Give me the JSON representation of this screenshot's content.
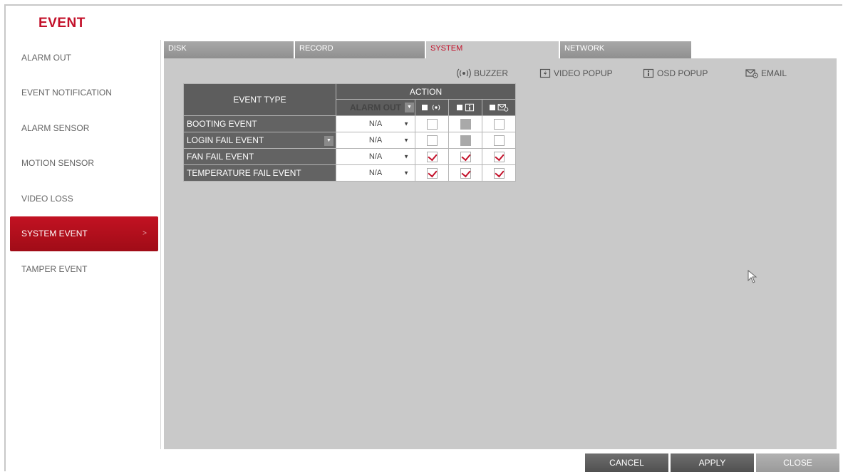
{
  "app_title": "EVENT",
  "sidebar": {
    "items": [
      {
        "label": "ALARM OUT"
      },
      {
        "label": "EVENT NOTIFICATION"
      },
      {
        "label": "ALARM SENSOR"
      },
      {
        "label": "MOTION SENSOR"
      },
      {
        "label": "VIDEO LOSS"
      },
      {
        "label": "SYSTEM EVENT",
        "active": true
      },
      {
        "label": "TAMPER EVENT"
      }
    ],
    "active_chevron": ">"
  },
  "tabs": [
    {
      "label": "DISK"
    },
    {
      "label": "RECORD"
    },
    {
      "label": "SYSTEM",
      "active": true
    },
    {
      "label": "NETWORK"
    }
  ],
  "legend": {
    "buzzer": "BUZZER",
    "video_popup": "VIDEO POPUP",
    "osd_popup": "OSD POPUP",
    "email": "EMAIL"
  },
  "table": {
    "event_type_header": "EVENT TYPE",
    "action_header": "ACTION",
    "alarm_out_header": "ALARM OUT",
    "rows": [
      {
        "event": "BOOTING EVENT",
        "alarm_out": "N/A",
        "buzzer": "unchecked",
        "osd": "disabled",
        "email": "unchecked"
      },
      {
        "event": "LOGIN FAIL EVENT",
        "alarm_out": "N/A",
        "buzzer": "unchecked",
        "osd": "disabled",
        "email": "unchecked",
        "has_dropdown": true
      },
      {
        "event": "FAN FAIL EVENT",
        "alarm_out": "N/A",
        "buzzer": "checked",
        "osd": "checked",
        "email": "checked"
      },
      {
        "event": "TEMPERATURE FAIL EVENT",
        "alarm_out": "N/A",
        "buzzer": "checked",
        "osd": "checked",
        "email": "checked"
      }
    ]
  },
  "buttons": {
    "cancel": "CANCEL",
    "apply": "APPLY",
    "close": "CLOSE"
  },
  "colors": {
    "accent": "#c3112a",
    "panel": "#c9c9c9",
    "header": "#5d5d5d"
  }
}
